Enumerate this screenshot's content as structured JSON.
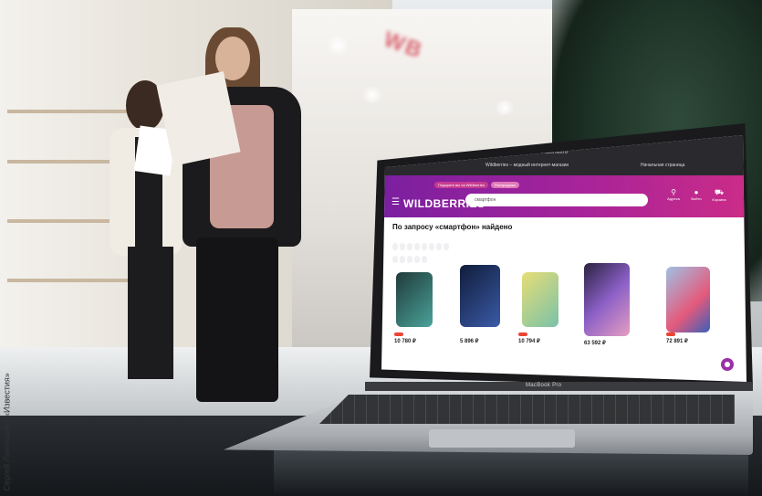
{
  "photo_credit": "Сергей Лантюхов / «Известия»",
  "laptop": {
    "brand_label": "MacBook Pro"
  },
  "browser": {
    "tabs": [
      "Wildberries – модный интернет-магазин",
      "Начальная страница"
    ],
    "address": "wildberries.ru"
  },
  "site": {
    "logo": "WILDBERRIES",
    "search_value": "смартфон",
    "pills": [
      "Подарите вы на Wildberries",
      "Распродажа"
    ],
    "actions": [
      {
        "label": "Адреса",
        "icon": "location-pin-icon"
      },
      {
        "label": "Войти",
        "icon": "user-icon"
      },
      {
        "label": "Корзина",
        "icon": "cart-icon"
      }
    ],
    "results_heading": "По запросу «смартфон» найдено",
    "results_count": "",
    "prices": [
      "10 780 ₽",
      "5 896 ₽",
      "10 794 ₽",
      "63 592 ₽",
      "72 891 ₽"
    ]
  },
  "colors": {
    "brand_gradient_start": "#7a1fa0",
    "brand_gradient_end": "#cb2c88"
  }
}
